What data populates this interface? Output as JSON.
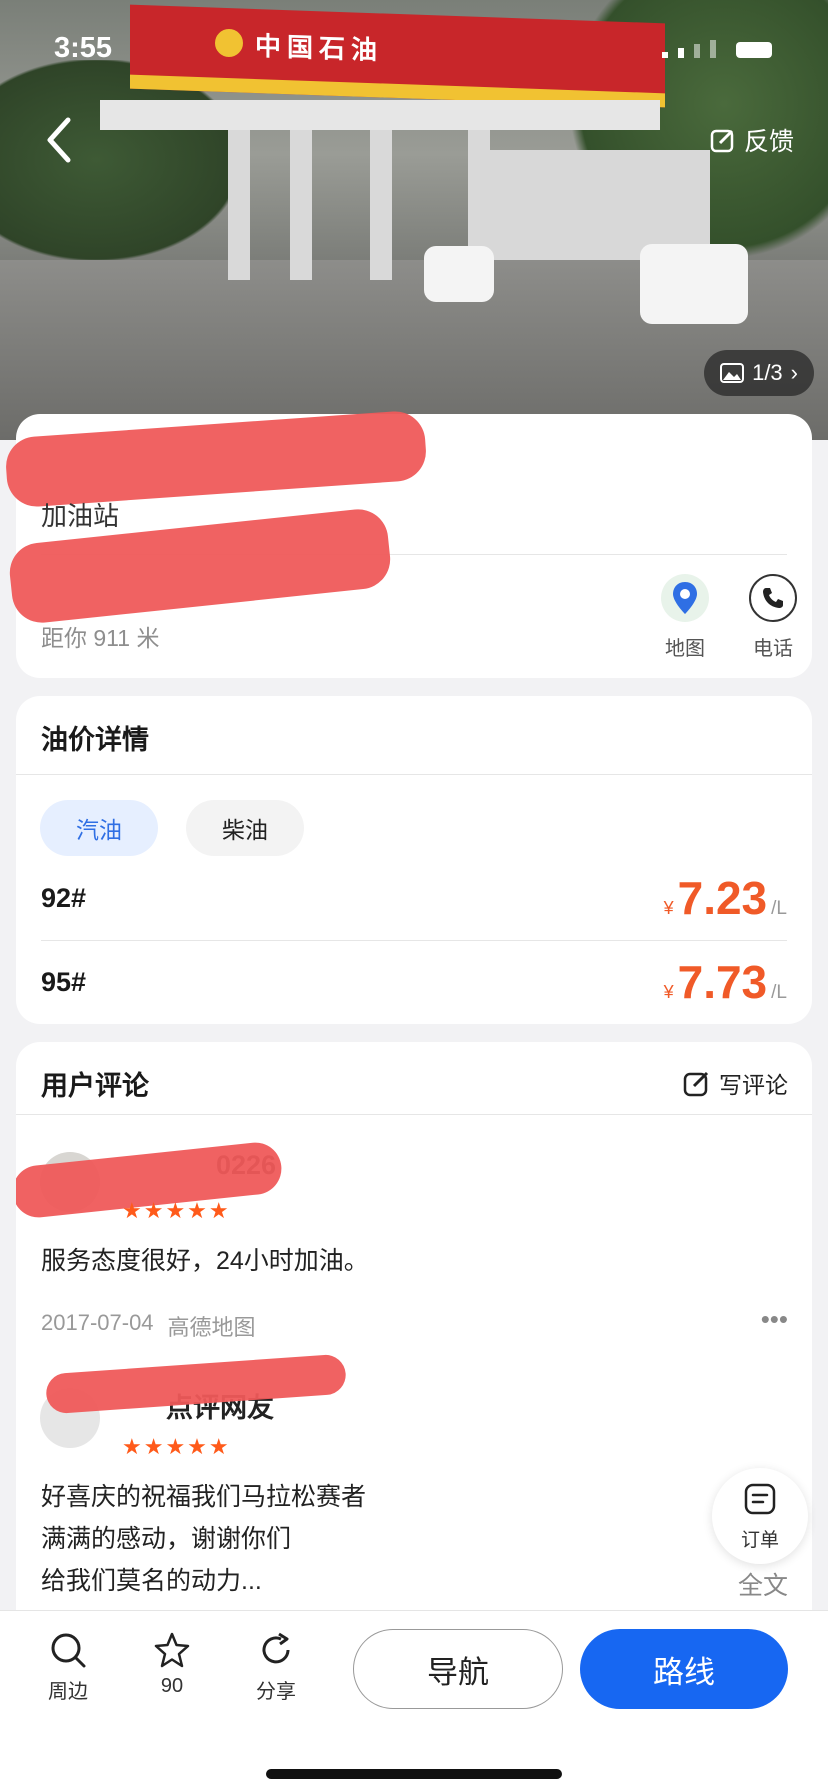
{
  "status_bar": {
    "time": "3:55"
  },
  "header": {
    "feedback_label": "反馈",
    "photo_counter": "1/3",
    "canopy_sign": "中国石油"
  },
  "place": {
    "type": "加油站",
    "distance": "距你 911 米",
    "actions": [
      {
        "label": "地图",
        "icon": "map-pin-icon"
      },
      {
        "label": "电话",
        "icon": "phone-icon"
      }
    ]
  },
  "prices": {
    "title": "油价详情",
    "tabs": [
      {
        "label": "汽油",
        "active": true
      },
      {
        "label": "柴油",
        "active": false
      }
    ],
    "rows": [
      {
        "grade": "92#",
        "currency": "¥",
        "price": "7.23",
        "unit": "/L"
      },
      {
        "grade": "95#",
        "currency": "¥",
        "price": "7.73",
        "unit": "/L"
      }
    ]
  },
  "reviews": {
    "title": "用户评论",
    "write_label": "写评论",
    "items": [
      {
        "user_suffix": "0226",
        "stars": "★★★★★",
        "text": "服务态度很好，24小时加油。",
        "date": "2017-07-04",
        "source": "高德地图"
      },
      {
        "user_suffix": "点评网友",
        "stars": "★★★★★",
        "text_lines": [
          "好喜庆的祝福我们马拉松赛者",
          "满满的感动，谢谢你们",
          "给我们莫名的动力..."
        ],
        "full_text_label": "全文"
      }
    ]
  },
  "floating": {
    "order_label": "订单"
  },
  "bottom_bar": {
    "nearby_label": "周边",
    "favorite_count": "90",
    "share_label": "分享",
    "navigate_label": "导航",
    "route_label": "路线"
  },
  "colors": {
    "accent_blue": "#1767f2",
    "price_orange": "#f05a28",
    "star_orange": "#ff5a1a",
    "redaction": "#ef5a5a"
  }
}
